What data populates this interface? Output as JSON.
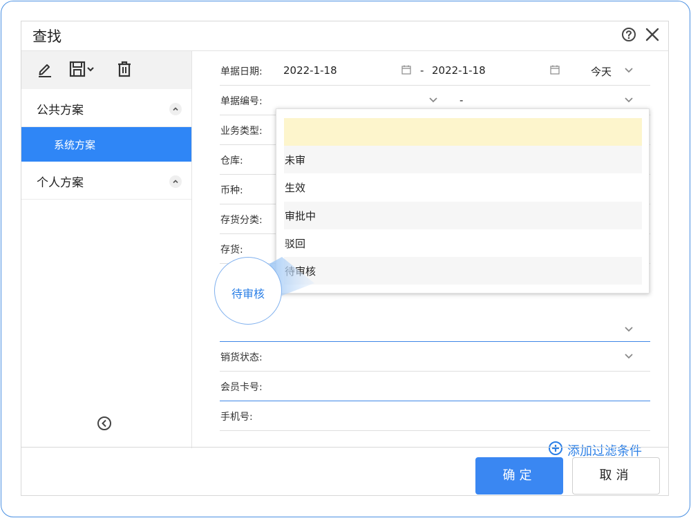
{
  "dialog": {
    "title": "查找"
  },
  "sidebar": {
    "public_group": "公共方案",
    "system_scheme": "系统方案",
    "personal_group": "个人方案"
  },
  "form": {
    "date_label": "单据日期:",
    "date_start": "2022-1-18",
    "date_sep": "-",
    "date_end": "2022-1-18",
    "date_quick": "今天",
    "docno_label": "单据编号:",
    "docno_sep": "-",
    "biz_type_label": "业务类型:",
    "warehouse_label": "仓库:",
    "currency_label": "币种:",
    "inv_category_label": "存货分类:",
    "inventory_label": "存货:",
    "sales_status_label": "销货状态:",
    "member_card_label": "会员卡号:",
    "phone_label": "手机号:"
  },
  "dropdown": {
    "options": [
      "",
      "未审",
      "生效",
      "审批中",
      "驳回",
      "待审核"
    ]
  },
  "callout": {
    "text": "待审核"
  },
  "actions": {
    "add_filter": "添加过滤条件",
    "ok": "确定",
    "cancel": "取消"
  },
  "colors": {
    "accent": "#2f86f6",
    "highlight": "#fdf5cc",
    "link": "#2b7fe6"
  }
}
